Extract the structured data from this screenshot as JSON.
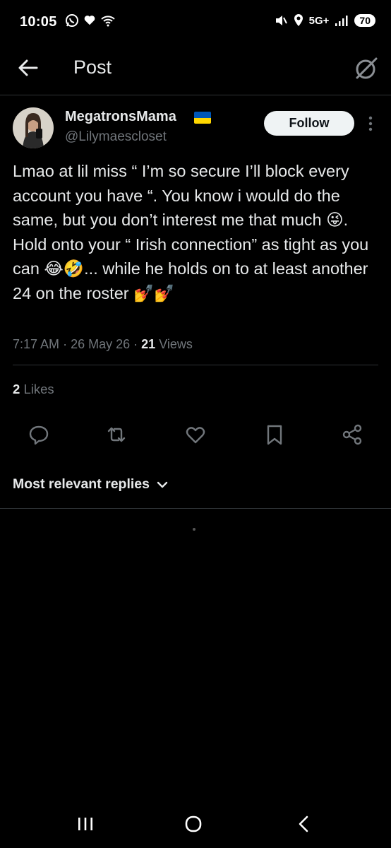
{
  "status_bar": {
    "time": "10:05",
    "network": "5G+",
    "battery": "70"
  },
  "header": {
    "title": "Post"
  },
  "post": {
    "display_name": "MegatronsMama",
    "handle": "@Lilymaescloset",
    "follow_label": "Follow",
    "body": "Lmao at lil miss “ I’m so secure I’ll block every account you have “. You know i would do the same, but you don’t interest me that much 😜.\nHold onto your “ Irish connection” as tight as you can 😂🤣... while he holds on to at least another 24 on the roster 💅💅",
    "time": "7:17 AM",
    "date": "26 May 26",
    "views_count": "21",
    "views_label": "Views",
    "likes_count": "2",
    "likes_label": "Likes"
  },
  "replies": {
    "sort_label": "Most relevant replies"
  },
  "icons": {
    "back": "arrow-left-icon",
    "grok": "grok-icon",
    "more": "more-vertical-icon",
    "reply": "reply-icon",
    "repost": "repost-icon",
    "like": "heart-icon",
    "bookmark": "bookmark-icon",
    "share": "share-icon"
  },
  "colors": {
    "background": "#000000",
    "text": "#e7e9ea",
    "secondary": "#71767b",
    "divider": "#2f3336"
  }
}
